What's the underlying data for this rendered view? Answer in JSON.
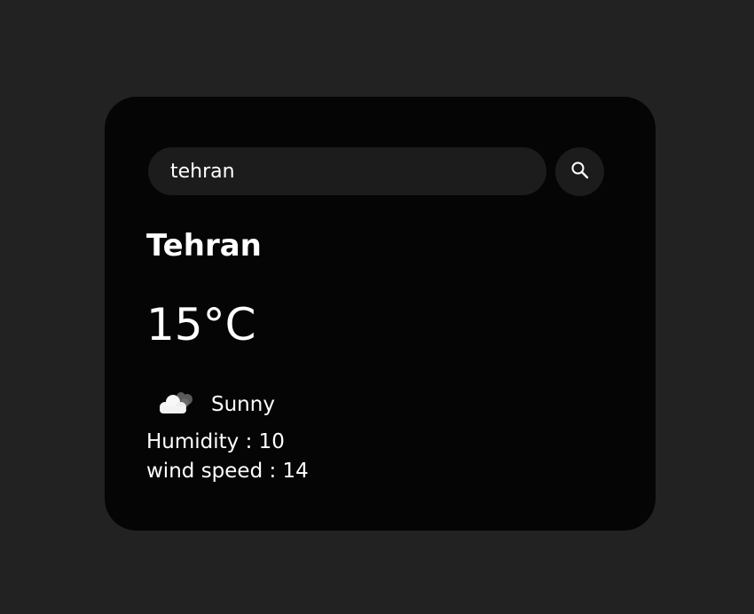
{
  "search": {
    "value": "tehran",
    "button_icon": "search-icon"
  },
  "weather": {
    "city": "Tehran",
    "temperature": "15°C",
    "condition_icon": "cloud-icon",
    "condition": "Sunny",
    "humidity_label": "Humidity : 10",
    "wind_label": "wind speed : 14"
  },
  "colors": {
    "background": "#222222",
    "card": "#050505",
    "input": "#1c1c1c",
    "text": "#ffffff"
  }
}
